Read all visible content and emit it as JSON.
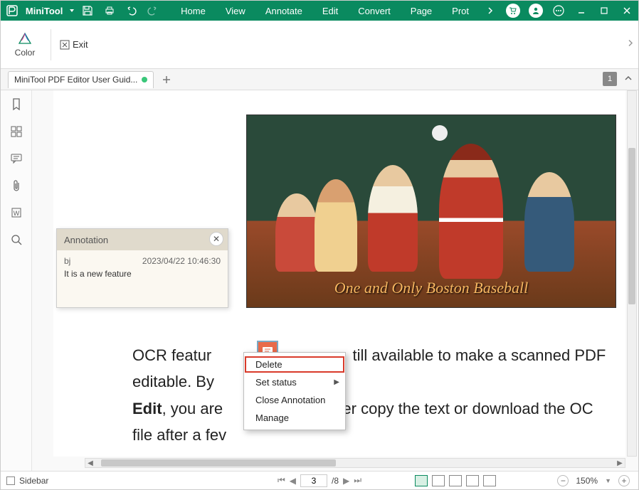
{
  "titlebar": {
    "brand": "MiniTool",
    "menus": [
      "Home",
      "View",
      "Annotate",
      "Edit",
      "Convert",
      "Page",
      "Prot"
    ]
  },
  "ribbon": {
    "color_label": "Color",
    "exit_label": "Exit"
  },
  "tabs": {
    "active": "MiniTool PDF Editor User Guid...",
    "page_indicator": "1"
  },
  "annotation": {
    "title": "Annotation",
    "author": "bj",
    "timestamp": "2023/04/22 10:46:30",
    "content": "It is a new feature"
  },
  "document": {
    "image_caption": "One and Only Boston Baseball",
    "text_before": "OCR featur",
    "text_after_1": "till available to make a scanned PDF editable. By",
    "text_line2_a": "Edit",
    "text_line2_b": ", you are",
    "text_line2_c": "er copy the text or download the OC",
    "text_line3": "file after a fev"
  },
  "context_menu": {
    "items": [
      "Delete",
      "Set status",
      "Close Annotation",
      "Manage"
    ],
    "highlighted": "Delete",
    "has_submenu": [
      "Set status"
    ]
  },
  "status": {
    "sidebar_label": "Sidebar",
    "current_page": "3",
    "total_pages": "/8",
    "zoom": "150%"
  }
}
